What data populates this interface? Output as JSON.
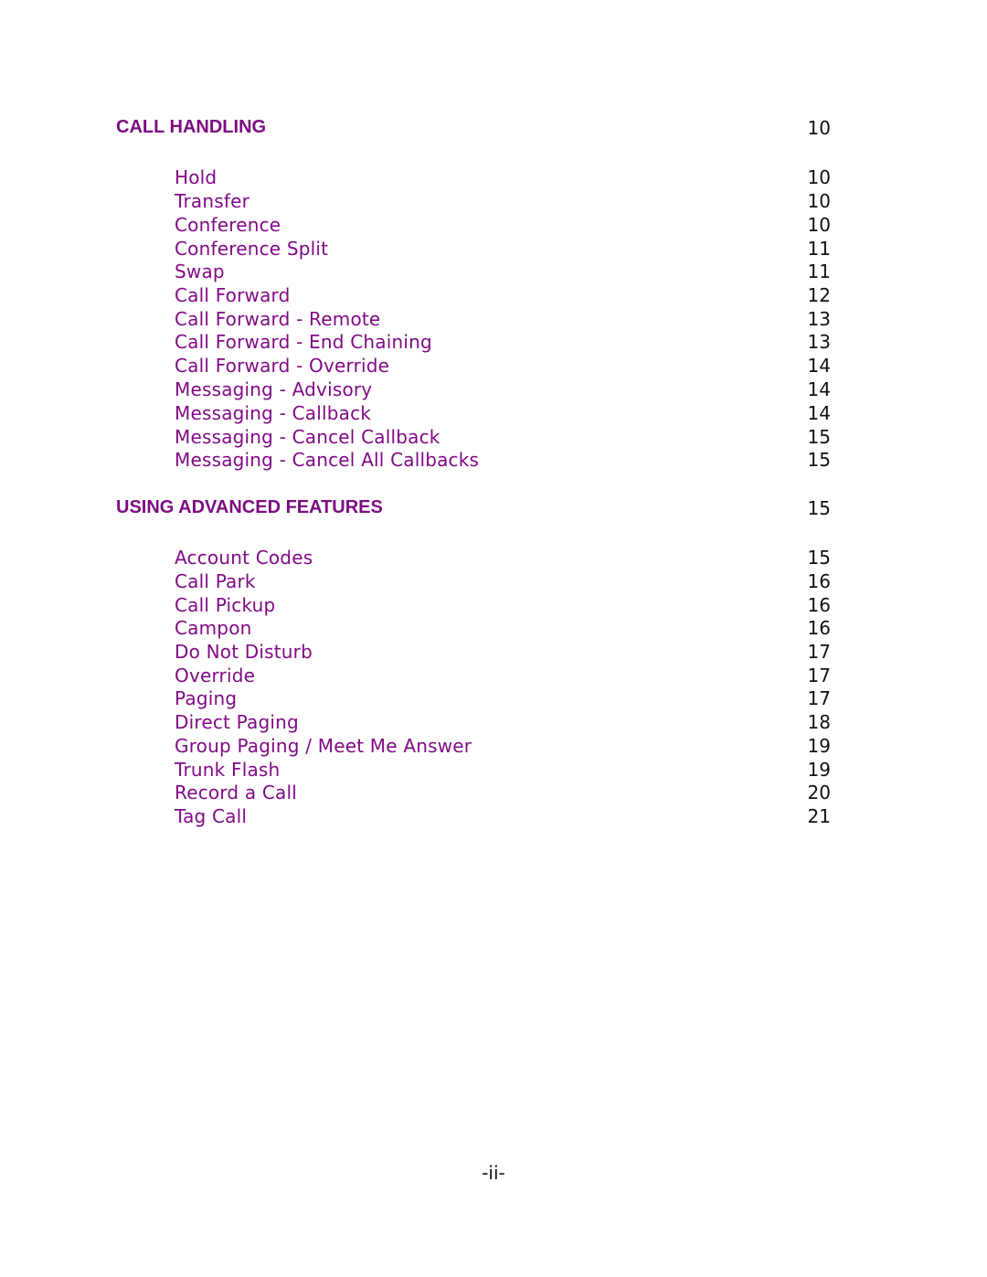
{
  "sections": [
    {
      "title": "CALL HANDLING",
      "page": "10",
      "entries": [
        {
          "label": "Hold",
          "page": "10"
        },
        {
          "label": "Transfer",
          "page": "10"
        },
        {
          "label": "Conference",
          "page": "10"
        },
        {
          "label": "Conference Split",
          "page": "11"
        },
        {
          "label": "Swap",
          "page": "11"
        },
        {
          "label": "Call Forward",
          "page": "12"
        },
        {
          "label": "Call Forward - Remote",
          "page": "13"
        },
        {
          "label": "Call Forward - End Chaining",
          "page": "13"
        },
        {
          "label": "Call Forward - Override",
          "page": "14"
        },
        {
          "label": "Messaging - Advisory",
          "page": "14"
        },
        {
          "label": "Messaging - Callback",
          "page": "14"
        },
        {
          "label": "Messaging - Cancel Callback",
          "page": "15"
        },
        {
          "label": "Messaging - Cancel All Callbacks",
          "page": "15"
        }
      ]
    },
    {
      "title": "USING ADVANCED FEATURES",
      "page": "15",
      "entries": [
        {
          "label": "Account Codes",
          "page": "15"
        },
        {
          "label": "Call Park",
          "page": "16"
        },
        {
          "label": "Call Pickup",
          "page": "16"
        },
        {
          "label": "Campon",
          "page": "16"
        },
        {
          "label": "Do Not Disturb",
          "page": "17"
        },
        {
          "label": "Override",
          "page": "17"
        },
        {
          "label": "Paging",
          "page": "17"
        },
        {
          "label": "Direct Paging",
          "page": "18"
        },
        {
          "label": "Group Paging / Meet Me Answer",
          "page": "19"
        },
        {
          "label": "Trunk Flash",
          "page": "19"
        },
        {
          "label": "Record a Call",
          "page": "20"
        },
        {
          "label": "Tag Call",
          "page": "21"
        }
      ]
    }
  ],
  "footer": {
    "page_number": "-ii-"
  }
}
